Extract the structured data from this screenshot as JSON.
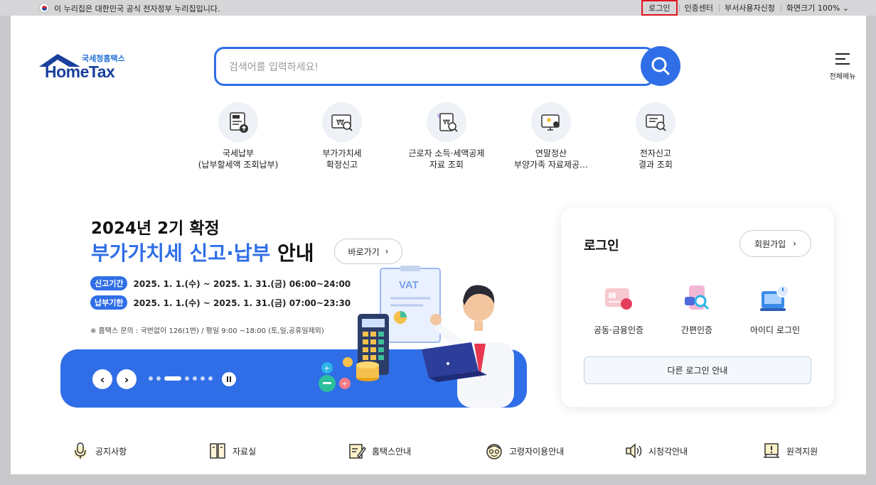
{
  "gov_bar": {
    "notice": "이 누리집은 대한민국 공식 전자정부 누리집입니다.",
    "links": [
      {
        "label": "로그인",
        "key": "login"
      },
      {
        "label": "인증센터",
        "key": "cert"
      },
      {
        "label": "부서사용자신청",
        "key": "dept"
      },
      {
        "label": "화면크기 100%",
        "key": "zoom"
      }
    ]
  },
  "header": {
    "logo_sub": "국세청홈택스",
    "logo_main": "HomeTax",
    "search_placeholder": "검색어를 입력하세요!",
    "menu_label": "전체메뉴"
  },
  "quick_services": [
    {
      "line1": "국세납부",
      "line2": "(납부할세액 조회납부)",
      "icon": "tax-payment-icon"
    },
    {
      "line1": "부가가치세",
      "line2": "확정신고",
      "icon": "vat-report-icon"
    },
    {
      "line1": "근로자 소득·세액공제",
      "line2": "자료 조회",
      "icon": "worker-deduction-icon"
    },
    {
      "line1": "연말정산",
      "line2": "부양가족 자료제공…",
      "icon": "year-end-settlement-icon"
    },
    {
      "line1": "전자신고",
      "line2": "결과 조회",
      "icon": "e-filing-result-icon"
    }
  ],
  "banner": {
    "title1": "2024년 2기 확정",
    "title2_blue": "부가가치세 신고·납부",
    "title2_dark": " 안내",
    "go_label": "바로가기",
    "periods": [
      {
        "pill": "신고기간",
        "text": "2025. 1. 1.(수) ~ 2025. 1. 31.(금) 06:00~24:00"
      },
      {
        "pill": "납부기한",
        "text": "2025. 1. 1.(수) ~ 2025. 1. 31.(금) 07:00~23:30"
      }
    ],
    "note": "※ 홈택스 문의 : 국번없이 126(1번) / 평일 9:00 ~18:00 (토,일,공휴일제외)",
    "vat_label": "VAT",
    "slide_count": 7,
    "active_slide": 3
  },
  "login": {
    "title": "로그인",
    "join_label": "회원가입",
    "options": [
      {
        "label": "공동·금융인증",
        "icon": "certificate-icon"
      },
      {
        "label": "간편인증",
        "icon": "simple-auth-icon"
      },
      {
        "label": "아이디 로그인",
        "icon": "id-login-icon"
      }
    ],
    "other_label": "다른 로그인 안내"
  },
  "bottom_links": [
    {
      "label": "공지사항",
      "icon": "microphone-icon"
    },
    {
      "label": "자료실",
      "icon": "archive-icon"
    },
    {
      "label": "홈택스안내",
      "icon": "guide-icon"
    },
    {
      "label": "고령자이용안내",
      "icon": "senior-icon"
    },
    {
      "label": "시청각안내",
      "icon": "speaker-icon"
    },
    {
      "label": "원격지원",
      "icon": "remote-support-icon"
    }
  ],
  "colors": {
    "primary": "#2f6ee6",
    "navy": "#1a3f9c",
    "highlight_red": "#e0141d"
  }
}
